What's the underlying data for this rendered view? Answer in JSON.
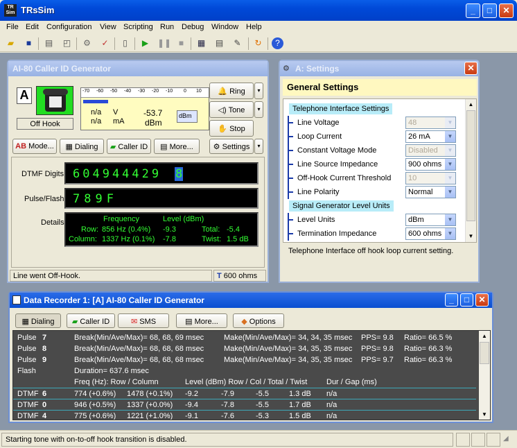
{
  "app": {
    "title": "TRsSim",
    "icon_text_top": "TR",
    "icon_text_bottom": "Sim"
  },
  "menu": [
    "File",
    "Edit",
    "Configuration",
    "View",
    "Scripting",
    "Run",
    "Debug",
    "Window",
    "Help"
  ],
  "caller_id": {
    "title": "AI-80  Caller ID Generator",
    "channel": "A",
    "hook_state": "Off Hook",
    "scale": [
      "-70",
      "-60",
      "-50",
      "-40",
      "-30",
      "-20",
      "-10",
      "0",
      "10"
    ],
    "voltage_value": "n/a",
    "voltage_unit": "V",
    "current_value": "n/a",
    "current_unit": "mA",
    "level_value": "-53.7",
    "level_unit": "dBm",
    "level_badge": "dBm",
    "buttons": {
      "ring": "Ring",
      "tone": "Tone",
      "stop": "Stop",
      "settings": "Settings"
    },
    "tabs": {
      "mode": "Mode...",
      "dialing": "Dialing",
      "caller_id": "Caller ID",
      "more": "More..."
    },
    "dtmf_label": "DTMF Digits",
    "dtmf_digits": "604944429",
    "dtmf_cursor": "8",
    "pulse_label": "Pulse/Flash",
    "pulse_digits": "789F",
    "details_label": "Details",
    "details": {
      "freq_header": "Frequency",
      "level_header": "Level (dBm)",
      "row_label": "Row:",
      "row_freq": "856 Hz (0.4%)",
      "row_level": "-9.3",
      "total_label": "Total:",
      "total_value": "-5.4",
      "col_label": "Column:",
      "col_freq": "1337 Hz (0.1%)",
      "col_level": "-7.8",
      "twist_label": "Twist:",
      "twist_value": "1.5 dB"
    },
    "status": "Line went Off-Hook.",
    "impedance": "600 ohms"
  },
  "settings": {
    "title": "A:  Settings",
    "header": "General Settings",
    "group1": "Telephone Interface Settings",
    "rows1": [
      {
        "label": "Line Voltage",
        "value": "48",
        "disabled": true
      },
      {
        "label": "Loop Current",
        "value": "26 mA",
        "disabled": false
      },
      {
        "label": "Constant Voltage Mode",
        "value": "Disabled",
        "disabled": true
      },
      {
        "label": "Line Source Impedance",
        "value": "900 ohms",
        "disabled": false
      },
      {
        "label": "Off-Hook Current Threshold",
        "value": "10",
        "disabled": true
      },
      {
        "label": "Line Polarity",
        "value": "Normal",
        "disabled": false
      }
    ],
    "group2": "Signal Generator Level Units",
    "rows2": [
      {
        "label": "Level Units",
        "value": "dBm",
        "disabled": false
      },
      {
        "label": "Termination Impedance",
        "value": "600 ohms",
        "disabled": false
      }
    ],
    "description": "Telephone Interface off hook loop current setting."
  },
  "recorder": {
    "title": "Data Recorder 1:  [A] AI-80  Caller ID Generator",
    "tabs": {
      "dialing": "Dialing",
      "caller_id": "Caller ID",
      "sms": "SMS",
      "more": "More...",
      "options": "Options"
    },
    "pulses": [
      {
        "type": "Pulse",
        "digit": "7",
        "break": "Break(Min/Ave/Max)= 68, 68, 69 msec",
        "make": "Make(Min/Ave/Max)= 34, 34, 35 msec",
        "pps": "PPS= 9.8",
        "ratio": "Ratio= 66.5 %"
      },
      {
        "type": "Pulse",
        "digit": "8",
        "break": "Break(Min/Ave/Max)= 68, 68, 68 msec",
        "make": "Make(Min/Ave/Max)= 34, 35, 35 msec",
        "pps": "PPS= 9.8",
        "ratio": "Ratio= 66.3 %"
      },
      {
        "type": "Pulse",
        "digit": "9",
        "break": "Break(Min/Ave/Max)= 68, 68, 68 msec",
        "make": "Make(Min/Ave/Max)= 34, 35, 35 msec",
        "pps": "PPS= 9.7",
        "ratio": "Ratio= 66.3 %"
      }
    ],
    "flash": {
      "type": "Flash",
      "duration": "Duration= 637.6 msec"
    },
    "dtmf_header": {
      "freq": "Freq (Hz):  Row / Column",
      "level": "Level (dBm) Row / Col / Total / Twist",
      "dur": "Dur / Gap (ms)"
    },
    "dtmf": [
      {
        "type": "DTMF",
        "digit": "6",
        "row": "774 (+0.6%)",
        "col": "1478 (+0.1%)",
        "lrow": "-9.2",
        "lcol": "-7.9",
        "total": "-5.5",
        "twist": "1.3 dB",
        "dur": "n/a"
      },
      {
        "type": "DTMF",
        "digit": "0",
        "row": "946 (+0.5%)",
        "col": "1337 (+0.0%)",
        "lrow": "-9.4",
        "lcol": "-7.8",
        "total": "-5.5",
        "twist": "1.7 dB",
        "dur": "n/a"
      },
      {
        "type": "DTMF",
        "digit": "4",
        "row": "775 (+0.6%)",
        "col": "1221 (+1.0%)",
        "lrow": "-9.1",
        "lcol": "-7.6",
        "total": "-5.3",
        "twist": "1.5 dB",
        "dur": "n/a"
      }
    ]
  },
  "status_bar": "Starting tone with on-to-off hook transition is disabled.",
  "colors": {
    "titlebar": "#0049d8",
    "lcd_green": "#33ff33",
    "settings_header": "#fff8c0",
    "group_header": "#b8ecf8",
    "recorder_bg": "#4a4a4a"
  }
}
